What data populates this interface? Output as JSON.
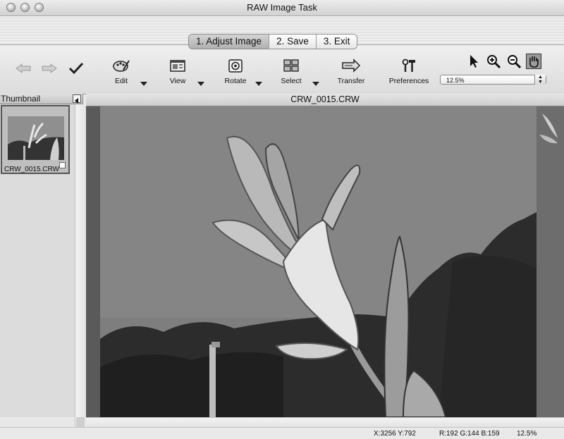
{
  "window": {
    "title": "RAW Image Task"
  },
  "steps": [
    "1. Adjust Image",
    "2. Save",
    "3. Exit"
  ],
  "toolbar": {
    "edit": "Edit",
    "view": "View",
    "rotate": "Rotate",
    "select": "Select",
    "transfer": "Transfer",
    "preferences": "Preferences",
    "zoom_value": "12.5%"
  },
  "sidebar": {
    "header": "Thumbnail",
    "thumbnail_name": "CRW_0015.CRW"
  },
  "viewer": {
    "filename": "CRW_0015.CRW"
  },
  "status": {
    "coords": "X:3256 Y:792",
    "rgb": "R:192 G:144 B:159",
    "zoom": "12.5%"
  }
}
